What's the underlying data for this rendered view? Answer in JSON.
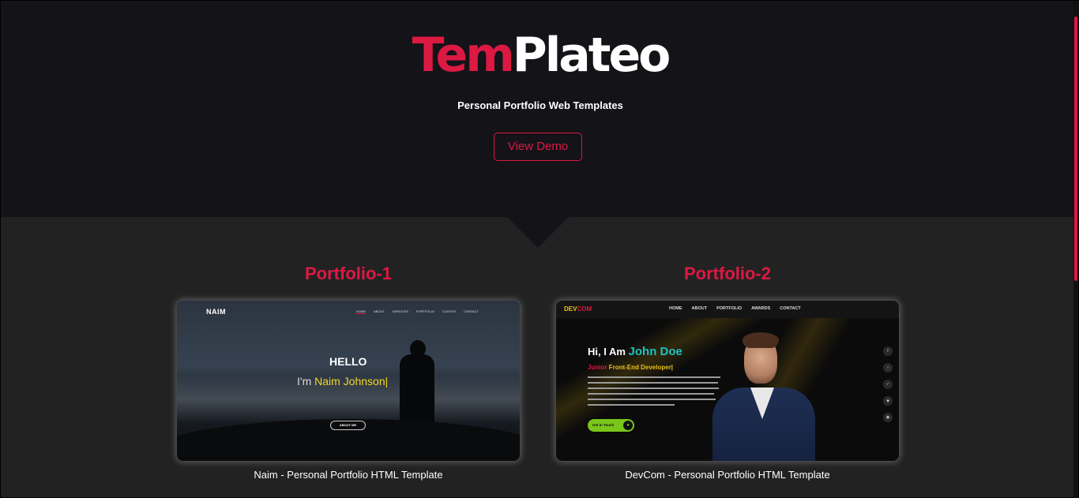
{
  "hero": {
    "brand_part1": "Tem",
    "brand_part2": "Plateo",
    "tagline": "Personal Portfolio Web Templates",
    "demo_button": "View Demo"
  },
  "colors": {
    "accent": "#dc1942",
    "hero_bg": "#131318",
    "page_bg": "#222223"
  },
  "portfolios": [
    {
      "title": "Portfolio-1",
      "caption": "Naim - Personal Portfolio HTML Template",
      "preview": {
        "logo": "NAIM",
        "nav": [
          "HOME",
          "ABOUT",
          "SERVICES",
          "PORTFOLIO",
          "CLIENTS",
          "CONTACT"
        ],
        "hello": "HELLO",
        "im": "I'm",
        "name": "Naim Johnson|",
        "button": "ABOUT ME"
      }
    },
    {
      "title": "Portfolio-2",
      "caption": "DevCom - Personal Portfolio HTML Template",
      "preview": {
        "logo_part1": "DEV",
        "logo_part2": "COM",
        "nav": [
          "HOME",
          "ABOUT",
          "PORTFOLIO",
          "AWARDS",
          "CONTACT"
        ],
        "hi": "Hi, I Am",
        "name": "John Doe",
        "role_part1": "Junior",
        "role_part2": "Front-End Developer|",
        "button": "Get In Touch",
        "social_icons": [
          "facebook-icon",
          "instagram-icon",
          "twitter-icon",
          "linkedin-icon",
          "github-icon"
        ]
      }
    }
  ]
}
